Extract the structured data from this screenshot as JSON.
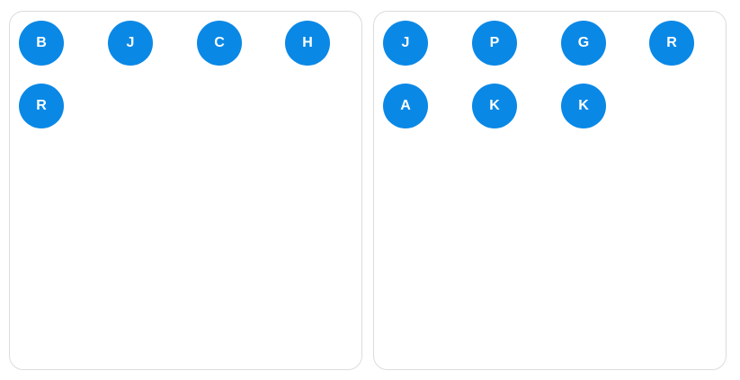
{
  "theme": {
    "avatar_color": "#0a88e6",
    "avatar_text_color": "#ffffff",
    "panel_border_color": "#dcdcdc"
  },
  "panels": [
    {
      "avatars": [
        {
          "initial": "B"
        },
        {
          "initial": "J"
        },
        {
          "initial": "C"
        },
        {
          "initial": "H"
        },
        {
          "initial": "R"
        }
      ]
    },
    {
      "avatars": [
        {
          "initial": "J"
        },
        {
          "initial": "P"
        },
        {
          "initial": "G"
        },
        {
          "initial": "R"
        },
        {
          "initial": "A"
        },
        {
          "initial": "K"
        },
        {
          "initial": "K"
        }
      ]
    }
  ]
}
